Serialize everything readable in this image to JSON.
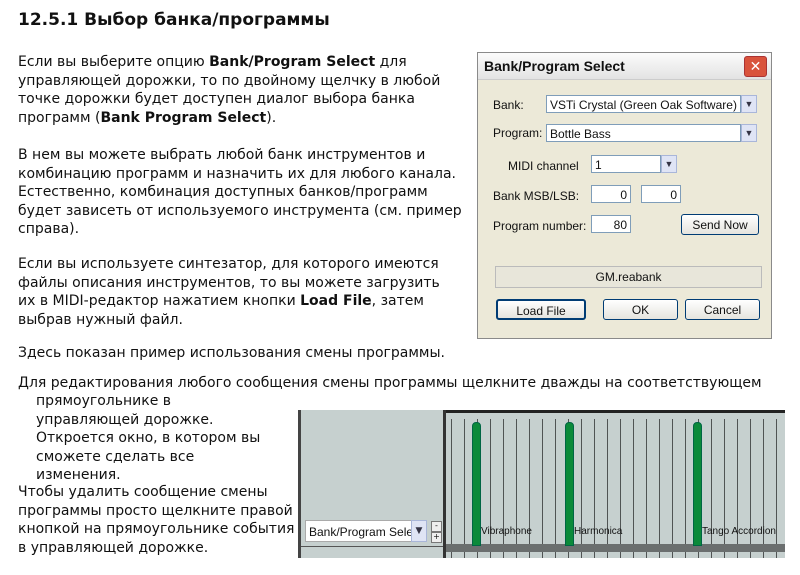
{
  "title": "12.5.1  Выбор банка/программы",
  "p1": {
    "a": "Если вы выберите опцию ",
    "b": "Bank/Program Select",
    "c": " для управляющей дорожки, то по двойному щелчку в любой точке дорожки будет доступен диалог выбора банка программ (",
    "d": "Bank Program Select",
    "e": ")."
  },
  "p2": "В нем вы можете выбрать любой банк инструментов и комбинацию программ и назначить их для любого канала. Естественно, комбинация доступных банков/программ будет зависеть от используемого инструмента (см. пример справа).",
  "p3": {
    "a": "Если вы используете синтезатор, для которого имеются файлы описания инструментов, то вы можете загрузить их в MIDI-редактор нажатием кнопки ",
    "b": "Load File",
    "c": ", затем выбрав нужный файл."
  },
  "p4": "Здесь показан пример использования смены программы.",
  "p5a": "Для редактирования любого сообщения смены программы щелкните дважды на соответствующем",
  "p5b": "прямоугольнике в управляющей дорожке. Откроется окно, в котором вы сможете сделать все изменения.",
  "p6": "Чтобы удалить сообщение смены программы просто щелкните правой кнопкой на прямоугольнике события в управляющей дорожке.",
  "dialog": {
    "title": "Bank/Program Select",
    "bank_label": "Bank:",
    "bank_value": "VSTi Crystal (Green Oak Software)",
    "program_label": "Program:",
    "program_value": "Bottle Bass",
    "midi_label": "MIDI channel",
    "midi_value": "1",
    "msb_label": "Bank MSB/LSB:",
    "msb": "0",
    "lsb": "0",
    "prog_num_label": "Program number:",
    "prog_num": "80",
    "send_now": "Send Now",
    "file": "GM.reabank",
    "load_file": "Load File",
    "ok": "OK",
    "cancel": "Cancel"
  },
  "track": {
    "lane_select": "Bank/Program Sele",
    "minus": "-",
    "plus": "+",
    "events": [
      "Vibraphone",
      "Harmonica",
      "Tango Accordion"
    ]
  }
}
